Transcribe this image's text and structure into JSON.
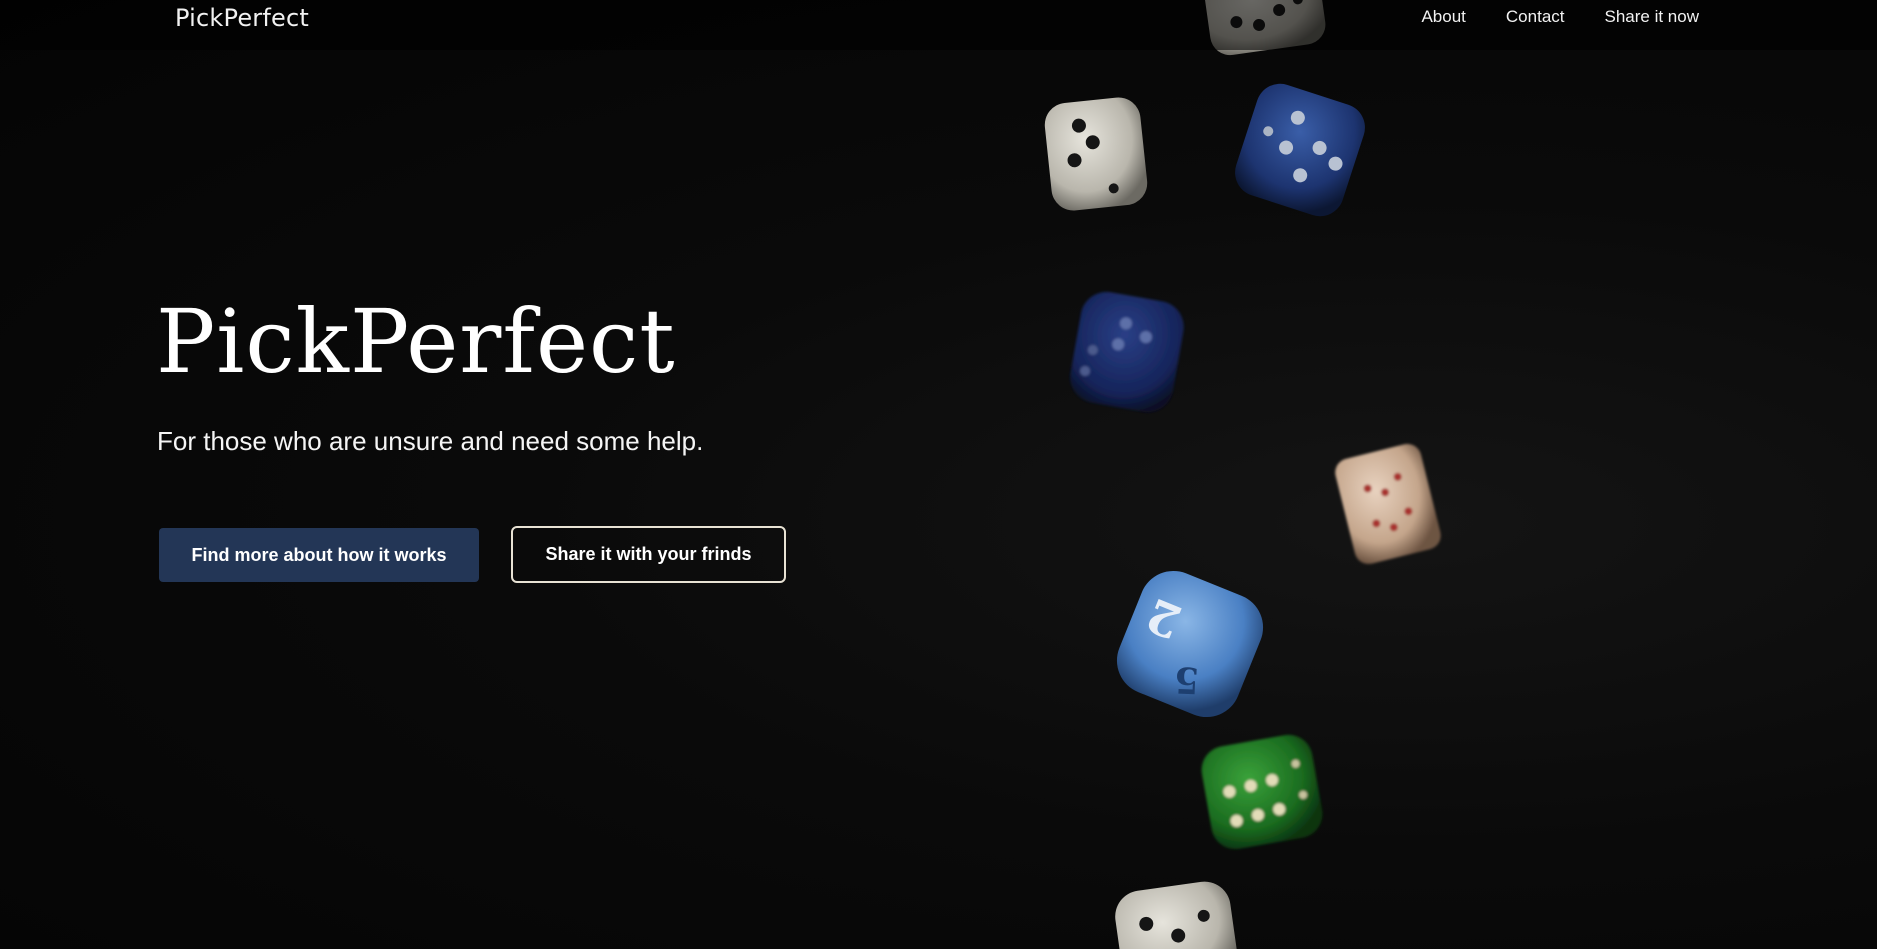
{
  "nav": {
    "brand": "PickPerfect",
    "links": [
      "About",
      "Contact",
      "Share it now"
    ]
  },
  "hero": {
    "title": "PickPerfect",
    "subtitle": "For those who are unsure and need some help.",
    "primary_button": "Find more about how it works",
    "secondary_button": "Share it with your frinds"
  },
  "colors": {
    "background": "#050505",
    "primary_button": "#233656",
    "outline_button_border": "#e8e2d4",
    "text": "#ffffff"
  },
  "dice_die_faces": [
    "5",
    "2"
  ]
}
